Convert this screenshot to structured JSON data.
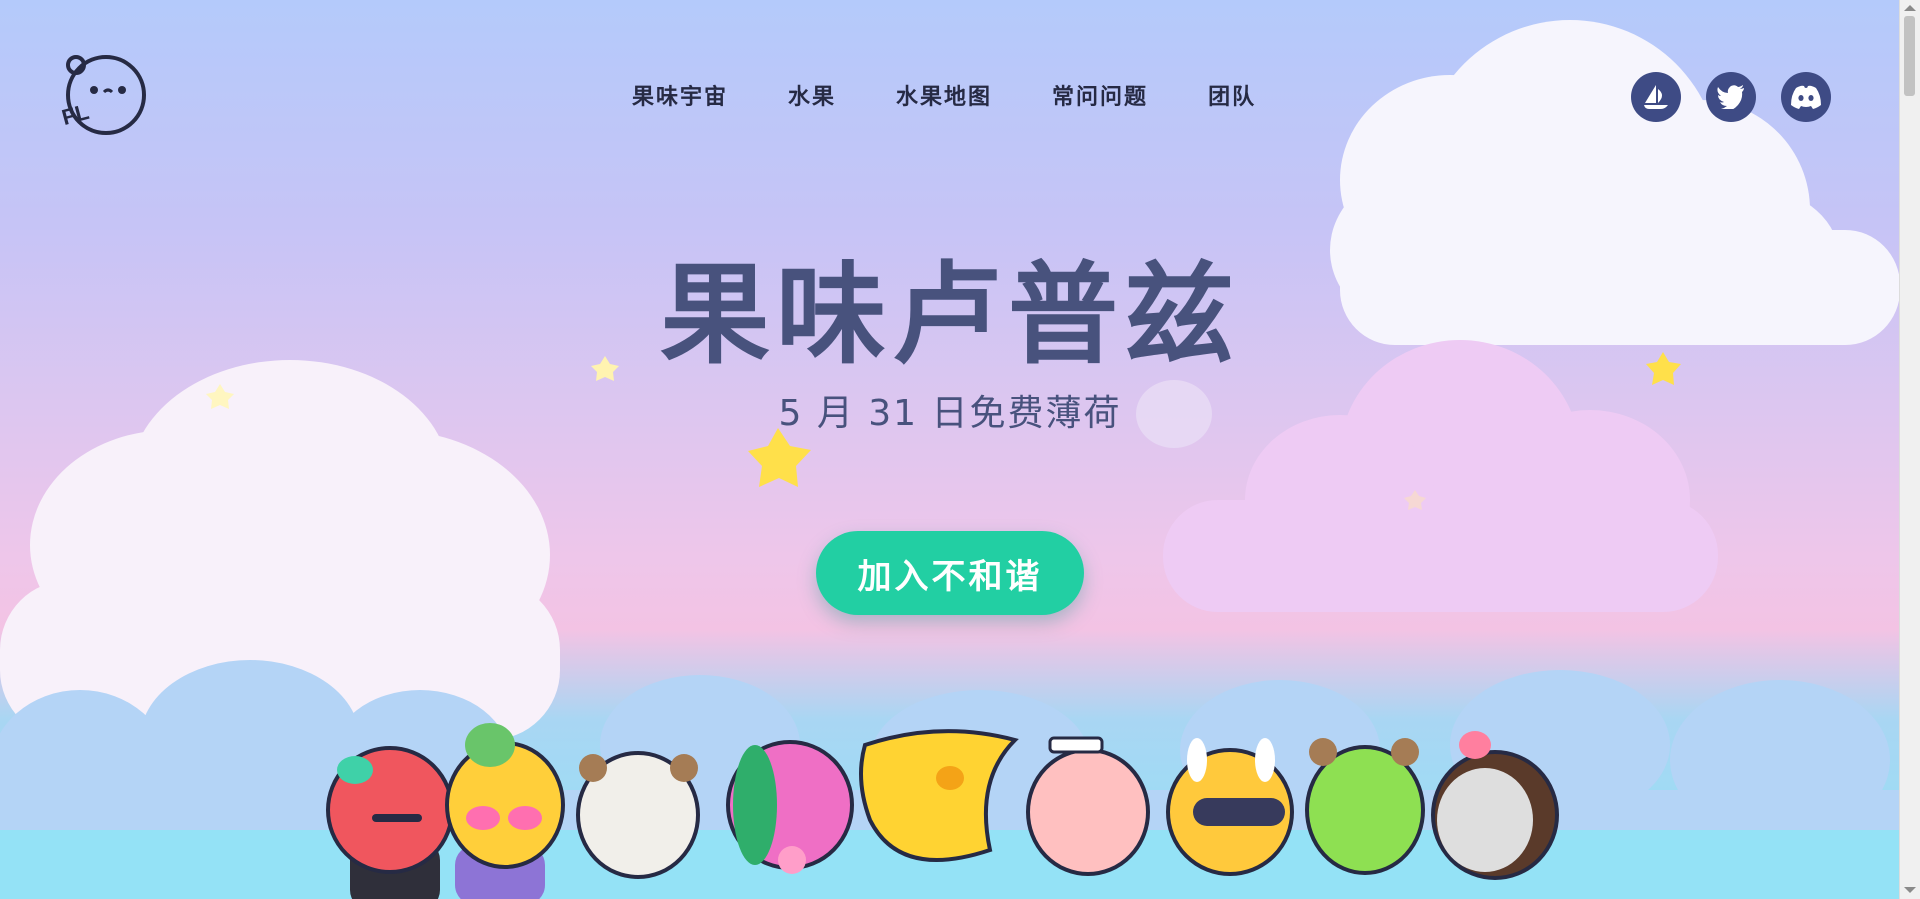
{
  "nav": {
    "links": [
      "果味宇宙",
      "水果",
      "水果地图",
      "常问问题",
      "团队"
    ]
  },
  "logo": {
    "text": "FL",
    "icon": "fruity-lupz-logo-icon"
  },
  "social": [
    {
      "name": "opensea-icon"
    },
    {
      "name": "twitter-icon"
    },
    {
      "name": "discord-icon"
    }
  ],
  "hero": {
    "title": "果味卢普兹",
    "subtitle": "5 月 31 日免费薄荷",
    "cta_label": "加入不和谐"
  },
  "colors": {
    "title": "#48527d",
    "cta": "#22cfa3",
    "social_bg": "#3e4b85",
    "nav_text": "#262a44"
  }
}
